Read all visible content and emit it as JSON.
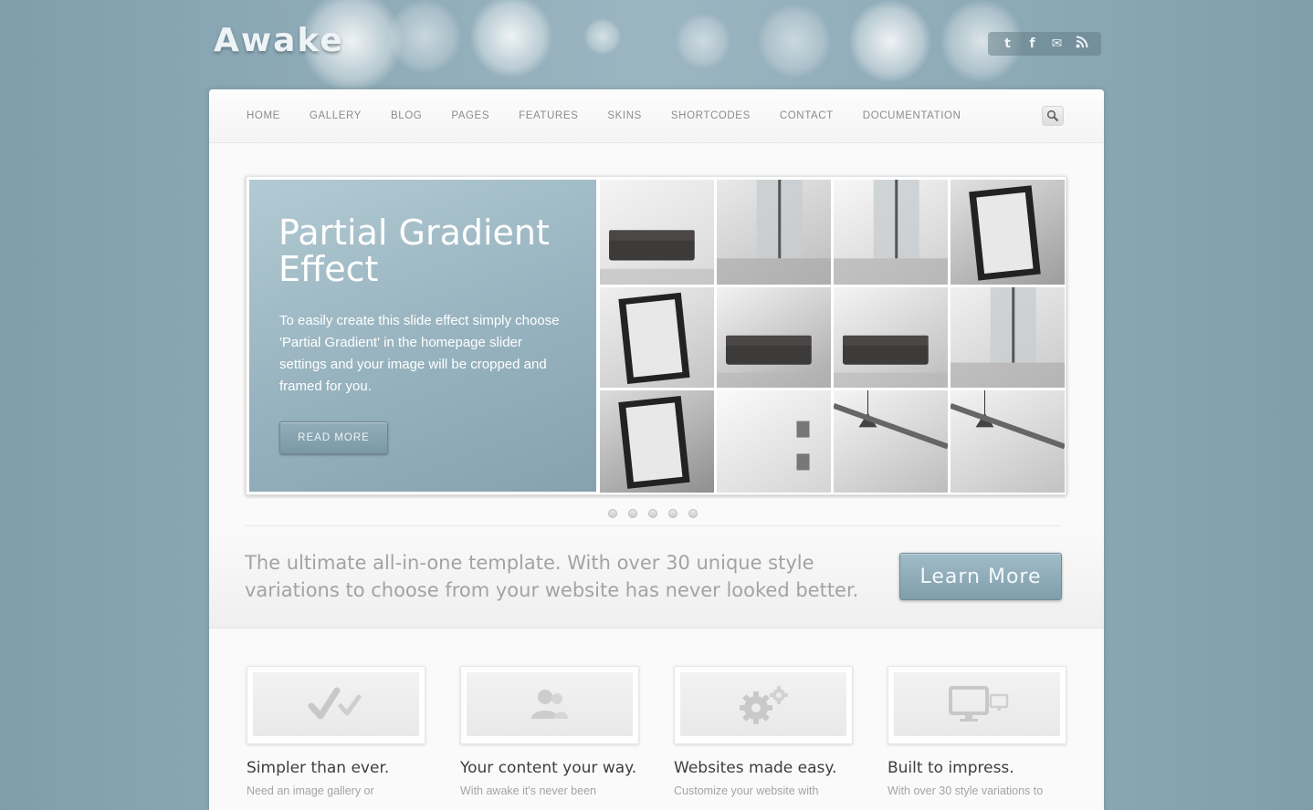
{
  "site": {
    "logo": "Awake"
  },
  "social": {
    "twitter": "t",
    "facebook": "f",
    "email": "✉",
    "rss": "◥"
  },
  "nav": {
    "items": [
      "HOME",
      "GALLERY",
      "BLOG",
      "PAGES",
      "FEATURES",
      "SKINS",
      "SHORTCODES",
      "CONTACT",
      "DOCUMENTATION"
    ]
  },
  "slider": {
    "title": "Partial Gradient Effect",
    "text": "To easily create this slide effect simply choose 'Partial Gradient' in the homepage slider settings and your image will be cropped and framed for you.",
    "button": "READ MORE",
    "dots": 5
  },
  "promo": {
    "text": "The ultimate all-in-one template. With over 30 unique style variations to choose from your website has never looked better.",
    "button": "Learn More"
  },
  "features": [
    {
      "title": "Simpler than ever.",
      "text": "Need an image gallery or",
      "icon": "checkmark-icon"
    },
    {
      "title": "Your content your way.",
      "text": "With awake it's never been",
      "icon": "users-icon"
    },
    {
      "title": "Websites made easy.",
      "text": "Customize your website with",
      "icon": "gears-icon"
    },
    {
      "title": "Built to impress.",
      "text": "With over 30 style variations to",
      "icon": "monitor-icon"
    }
  ],
  "colors": {
    "accent": "#86a2ae",
    "background": "#8ba8b5",
    "text": "#3e3e3e"
  }
}
